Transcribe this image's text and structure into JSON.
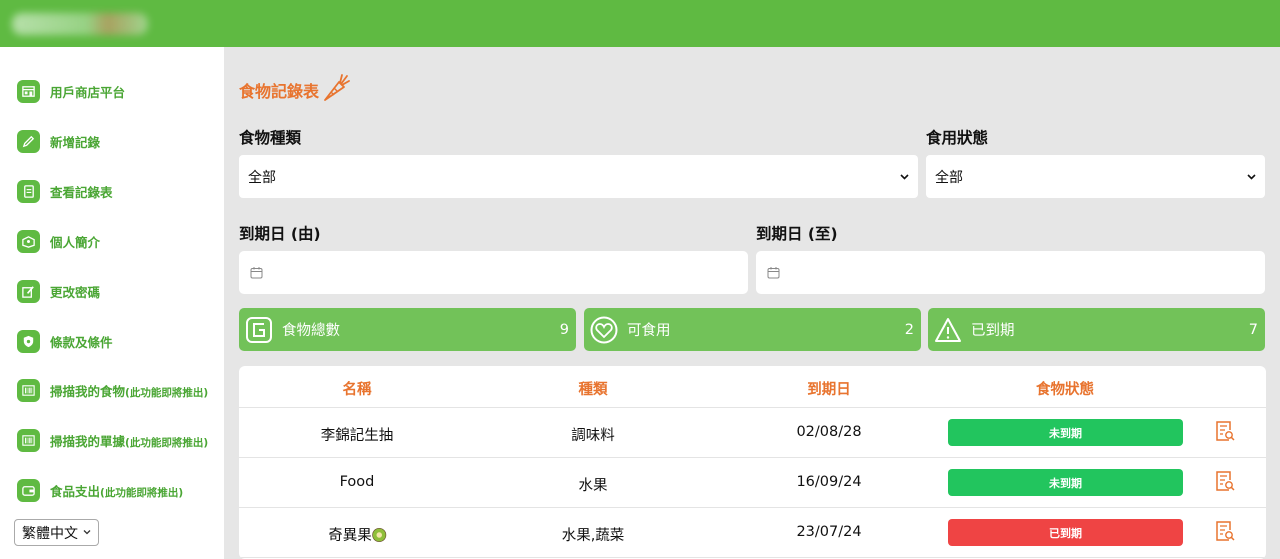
{
  "app": {
    "name": ""
  },
  "sidebar": {
    "items": [
      {
        "label": "用戶商店平台",
        "note": "",
        "icon": "store-icon"
      },
      {
        "label": "新增記錄",
        "note": "",
        "icon": "pencil-icon"
      },
      {
        "label": "查看記錄表",
        "note": "",
        "icon": "document-icon"
      },
      {
        "label": "個人簡介",
        "note": "",
        "icon": "profile-box-icon"
      },
      {
        "label": "更改密碼",
        "note": "",
        "icon": "edit-password-icon"
      },
      {
        "label": "條款及條件",
        "note": "",
        "icon": "shield-icon"
      },
      {
        "label": "掃描我的食物",
        "note": "(此功能即將推出)",
        "icon": "barcode-icon"
      },
      {
        "label": "掃描我的單據",
        "note": "(此功能即將推出)",
        "icon": "barcode-icon"
      },
      {
        "label": "食品支出",
        "note": "(此功能即將推出)",
        "icon": "wallet-icon"
      }
    ],
    "language": "繁體中文"
  },
  "page": {
    "title": "食物記錄表",
    "filters": {
      "food_type_label": "食物種類",
      "food_type_value": "全部",
      "status_label": "食用狀態",
      "status_value": "全部",
      "date_from_label": "到期日 (由)",
      "date_to_label": "到期日 (至)"
    },
    "stats": [
      {
        "label": "食物總數",
        "count": "9",
        "icon": "food-box-icon"
      },
      {
        "label": "可食用",
        "count": "2",
        "icon": "heart-icon"
      },
      {
        "label": "已到期",
        "count": "7",
        "icon": "warning-icon"
      }
    ],
    "table": {
      "columns": [
        "名稱",
        "種類",
        "到期日",
        "食物狀態"
      ],
      "rows": [
        {
          "name": "李錦記生抽",
          "type": "調味料",
          "expiry": "02/08/28",
          "status": "未到期",
          "status_color": "#22c55e"
        },
        {
          "name": "Food",
          "type": "水果",
          "expiry": "16/09/24",
          "status": "未到期",
          "status_color": "#22c55e"
        },
        {
          "name": "奇異果",
          "type": "水果,蔬菜",
          "expiry": "23/07/24",
          "status": "已到期",
          "status_color": "#ef4444"
        }
      ]
    }
  },
  "colors": {
    "brand_green": "#5fba42",
    "accent_orange": "#e8742f",
    "ok_green": "#22c55e",
    "expired_red": "#ef4444"
  }
}
